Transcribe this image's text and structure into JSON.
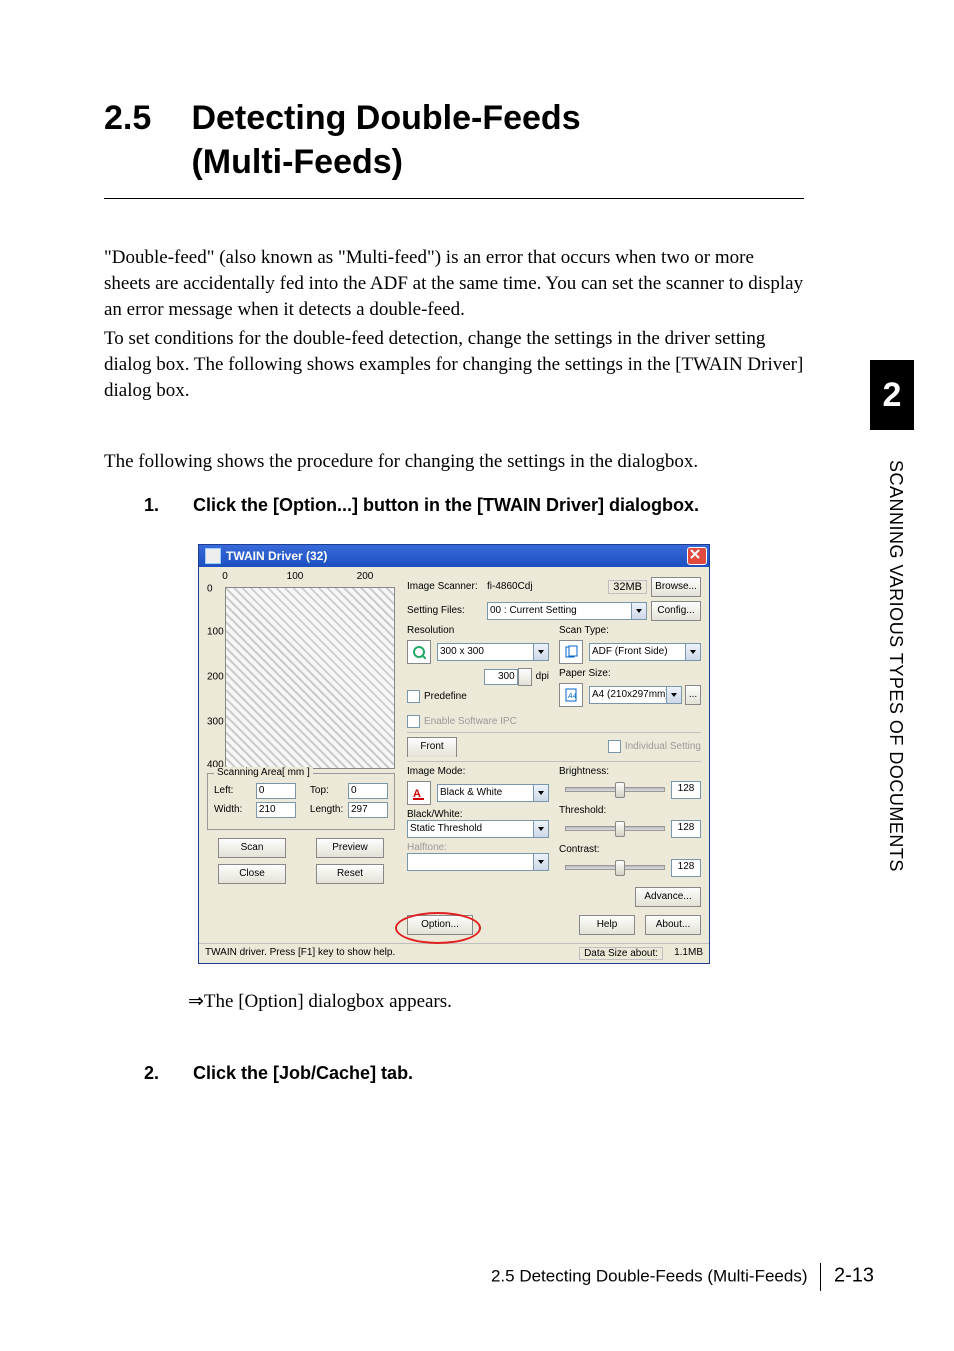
{
  "heading": {
    "number": "2.5",
    "title_line1": "Detecting Double-Feeds",
    "title_line2": "(Multi-Feeds)"
  },
  "para1": "\"Double-feed\" (also known as \"Multi-feed\") is an error that occurs when two or more sheets are accidentally fed into the ADF at the same time. You can set the scanner to display an error message when it detects a double-feed.",
  "para2": "To set conditions for the double-feed detection, change the settings in the driver setting dialog box. The following shows examples for changing the settings in the [TWAIN Driver] dialog box.",
  "para3": "The following shows the procedure for changing the settings in the dialogbox.",
  "step1": {
    "num": "1.",
    "text": "Click the [Option...] button in the [TWAIN Driver] dialogbox."
  },
  "result1": "⇒The [Option] dialogbox appears.",
  "step2": {
    "num": "2.",
    "text": "Click the [Job/Cache] tab."
  },
  "side": {
    "chapter": "2",
    "label": "SCANNING VARIOUS TYPES OF DOCUMENTS"
  },
  "footer": {
    "section": "2.5 Detecting Double-Feeds (Multi-Feeds)",
    "page": "2-13"
  },
  "dlg": {
    "title": "TWAIN Driver (32)",
    "ruler": {
      "h": [
        "0",
        "100",
        "200"
      ],
      "v": [
        "0",
        "100",
        "200",
        "300",
        "400"
      ]
    },
    "scanner_lbl": "Image Scanner:",
    "scanner_val": "fi-4860Cdj",
    "mem": "32MB",
    "browse": "Browse...",
    "setting_lbl": "Setting Files:",
    "setting_val": "00 : Current Setting",
    "config": "Config...",
    "resolution_lbl": "Resolution",
    "resolution_val": "300 x 300",
    "dpi_val": "300",
    "dpi_unit": "dpi",
    "predefine": "Predefine",
    "enable_ipc": "Enable Software IPC",
    "scantype_lbl": "Scan Type:",
    "scantype_val": "ADF (Front Side)",
    "papersize_lbl": "Paper Size:",
    "papersize_val": "A4 (210x297mm)",
    "front": "Front",
    "individual": "Individual Setting",
    "imagemode_lbl": "Image Mode:",
    "imagemode_val": "Black & White",
    "bw_lbl": "Black/White:",
    "bw_val": "Static Threshold",
    "halftone_lbl": "Halftone:",
    "brightness_lbl": "Brightness:",
    "brightness_val": "128",
    "threshold_lbl": "Threshold:",
    "threshold_val": "128",
    "contrast_lbl": "Contrast:",
    "contrast_val": "128",
    "area_title": "Scanning Area[ mm ]",
    "left_lbl": "Left:",
    "left_val": "0",
    "top_lbl": "Top:",
    "top_val": "0",
    "width_lbl": "Width:",
    "width_val": "210",
    "length_lbl": "Length:",
    "length_val": "297",
    "scan": "Scan",
    "preview": "Preview",
    "close": "Close",
    "reset": "Reset",
    "option": "Option...",
    "advance": "Advance...",
    "help": "Help",
    "about": "About...",
    "status": "TWAIN driver. Press [F1] key to show help.",
    "datasize_lbl": "Data Size about:",
    "datasize_val": "1.1MB"
  }
}
